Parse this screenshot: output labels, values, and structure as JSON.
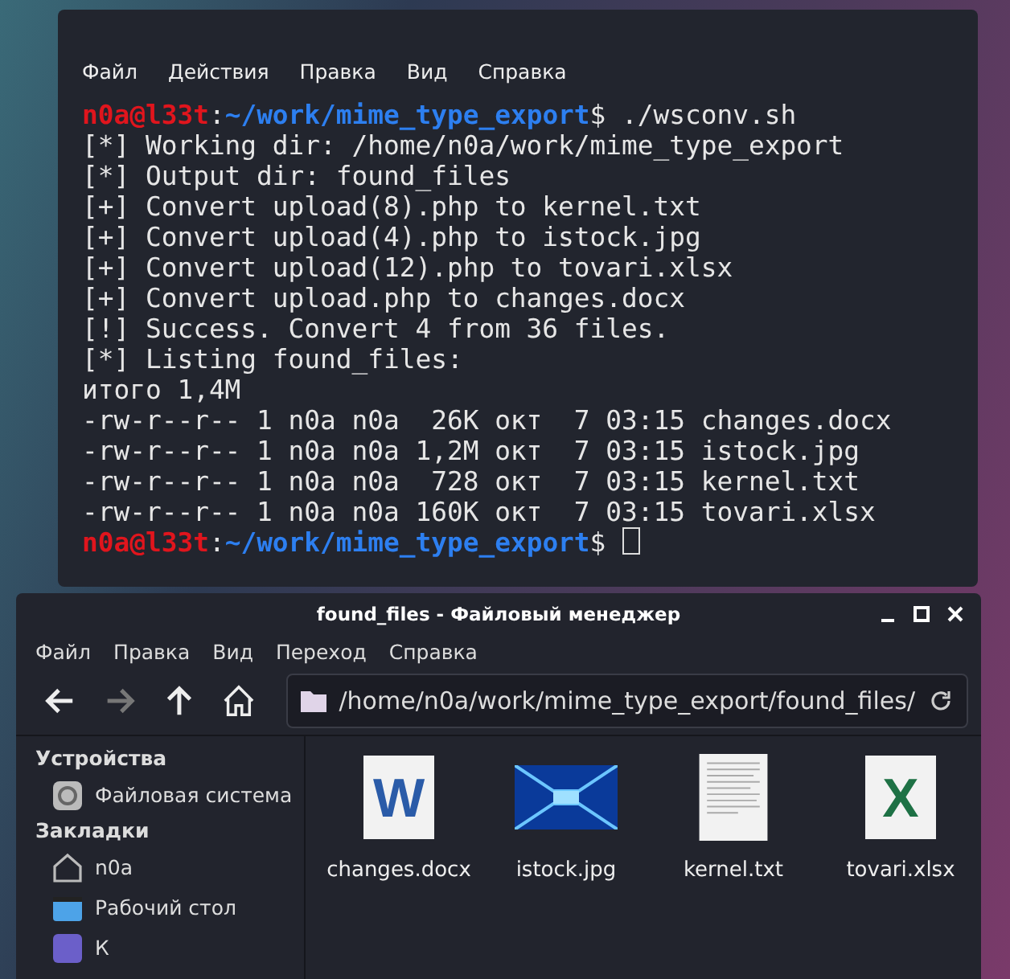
{
  "terminal": {
    "menu": [
      "Файл",
      "Действия",
      "Правка",
      "Вид",
      "Справка"
    ],
    "lines": [
      {
        "kind": "prompt",
        "user": "n0a@l33t",
        "sep": ":",
        "path": "~/work/mime_type_export",
        "sign": "$",
        "command": "./wsconv.sh",
        "cursor": false
      },
      {
        "kind": "output",
        "text": "[*] Working dir: /home/n0a/work/mime_type_export"
      },
      {
        "kind": "output",
        "text": "[*] Output dir: found_files"
      },
      {
        "kind": "output",
        "text": "[+] Convert upload(8).php to kernel.txt"
      },
      {
        "kind": "output",
        "text": "[+] Convert upload(4).php to istock.jpg"
      },
      {
        "kind": "output",
        "text": "[+] Convert upload(12).php to tovari.xlsx"
      },
      {
        "kind": "output",
        "text": "[+] Convert upload.php to changes.docx"
      },
      {
        "kind": "output",
        "text": "[!] Success. Convert 4 from 36 files."
      },
      {
        "kind": "output",
        "text": "[*] Listing found_files:"
      },
      {
        "kind": "output",
        "text": "итого 1,4M"
      },
      {
        "kind": "output",
        "text": "-rw-r--r-- 1 n0a n0a  26K окт  7 03:15 changes.docx"
      },
      {
        "kind": "output",
        "text": "-rw-r--r-- 1 n0a n0a 1,2M окт  7 03:15 istock.jpg"
      },
      {
        "kind": "output",
        "text": "-rw-r--r-- 1 n0a n0a  728 окт  7 03:15 kernel.txt"
      },
      {
        "kind": "output",
        "text": "-rw-r--r-- 1 n0a n0a 160K окт  7 03:15 tovari.xlsx"
      },
      {
        "kind": "prompt",
        "user": "n0a@l33t",
        "sep": ":",
        "path": "~/work/mime_type_export",
        "sign": "$",
        "cursor": true
      }
    ]
  },
  "file_manager": {
    "title": "found_files - Файловый менеджер",
    "menu": [
      "Файл",
      "Правка",
      "Вид",
      "Переход",
      "Справка"
    ],
    "toolbar": {
      "forward_disabled": true
    },
    "address": "/home/n0a/work/mime_type_export/found_files/",
    "sidebar": [
      {
        "heading": "Устройства",
        "items": [
          {
            "label": "Файловая система",
            "kind": "drive"
          }
        ]
      },
      {
        "heading": "Закладки",
        "items": [
          {
            "label": "n0a",
            "kind": "home"
          },
          {
            "label": "Рабочий стол",
            "kind": "folder"
          },
          {
            "label": "К",
            "kind": "app"
          }
        ]
      }
    ],
    "files": [
      {
        "name": "changes.docx",
        "kind": "word",
        "letter": "W"
      },
      {
        "name": "istock.jpg",
        "kind": "image"
      },
      {
        "name": "kernel.txt",
        "kind": "text"
      },
      {
        "name": "tovari.xlsx",
        "kind": "excel",
        "letter": "X"
      }
    ]
  }
}
